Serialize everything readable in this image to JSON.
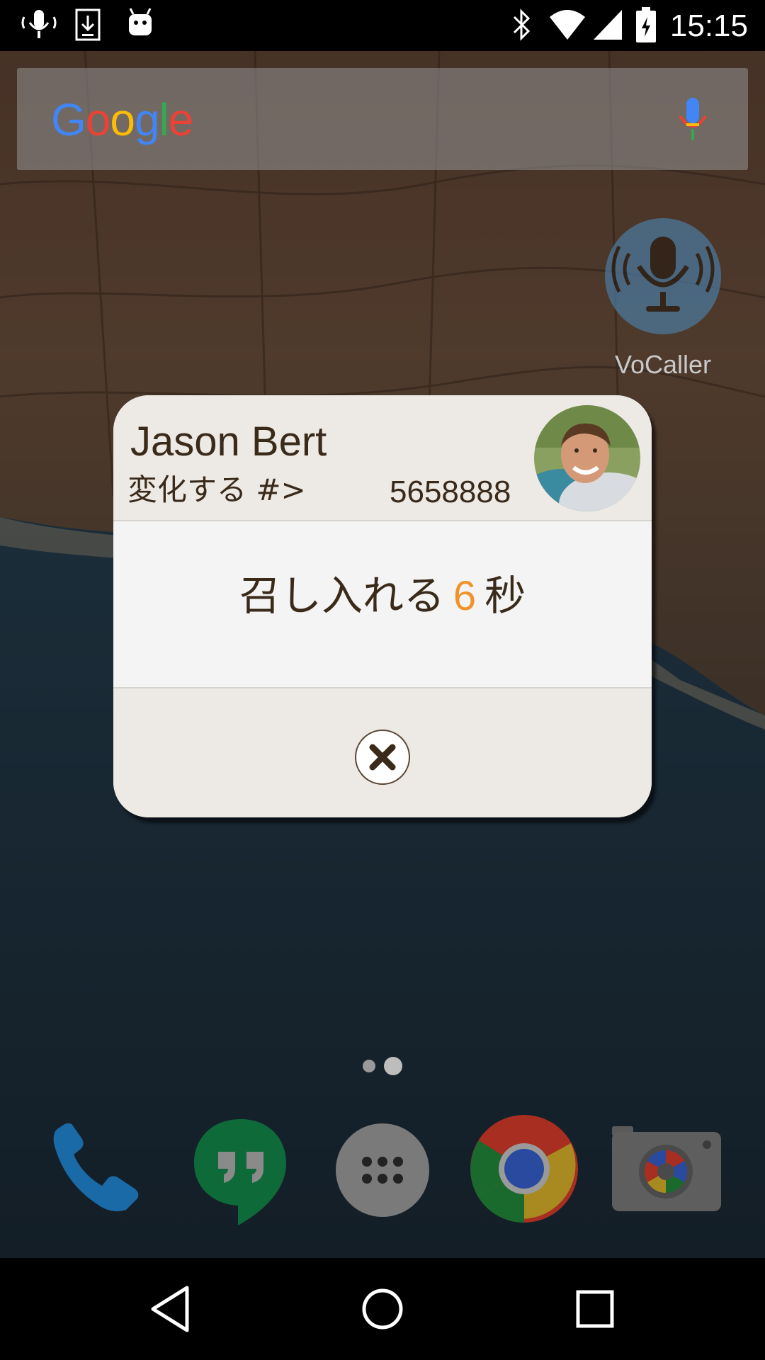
{
  "status_bar": {
    "time": "15:15",
    "icons": [
      "voice-input-icon",
      "download-icon",
      "android-icon",
      "bluetooth-icon",
      "wifi-icon",
      "signal-icon",
      "battery-icon"
    ]
  },
  "search_bar": {
    "logo_text": [
      "G",
      "o",
      "o",
      "g",
      "l",
      "e"
    ],
    "mic_icon": "mic-icon"
  },
  "app_shortcut": {
    "label": "VoCaller",
    "icon": "vocaller-mic-icon"
  },
  "dialog": {
    "contact_name": "Jason Bert",
    "subtitle": "変化する #>",
    "number": "5658888",
    "avatar_icon": "contact-photo",
    "countdown_prefix": "召し入れる",
    "countdown_value": "6",
    "countdown_suffix": "秒",
    "close_icon": "close-icon"
  },
  "page_indicator": {
    "count": 2,
    "active": 1
  },
  "dock": [
    {
      "name": "phone",
      "icon": "phone-icon"
    },
    {
      "name": "hangouts",
      "icon": "hangouts-icon"
    },
    {
      "name": "app-drawer",
      "icon": "app-drawer-icon"
    },
    {
      "name": "chrome",
      "icon": "chrome-icon"
    },
    {
      "name": "camera",
      "icon": "camera-icon"
    }
  ],
  "nav_bar": [
    "back-icon",
    "home-icon",
    "recents-icon"
  ],
  "colors": {
    "accent_countdown": "#f0932b",
    "dialog_text": "#3a2a1a",
    "dialog_header_bg": "#ede9e5",
    "dialog_body_bg": "#f4f4f4"
  }
}
